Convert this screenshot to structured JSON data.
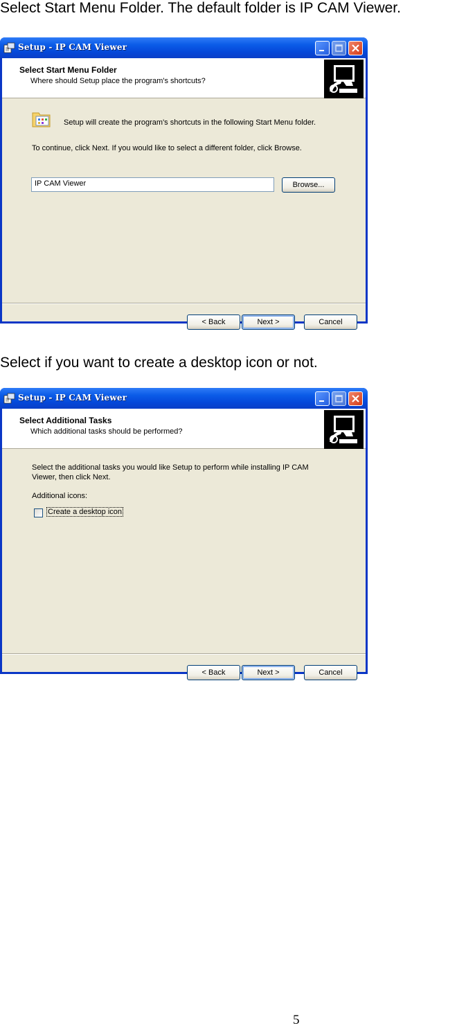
{
  "caption1": "Select Start Menu Folder. The default folder is IP CAM Viewer.",
  "caption2": "Select if you want to create a desktop icon or not.",
  "page_number": "5",
  "window1": {
    "title": "Setup - IP CAM Viewer",
    "header_title": "Select Start Menu Folder",
    "header_subtitle": "Where should Setup place the program's shortcuts?",
    "info_text": "Setup will create the program's shortcuts in the following Start Menu folder.",
    "instruction": "To continue, click Next. If you would like to select a different folder, click Browse.",
    "folder_value": "IP CAM Viewer",
    "browse_label": "Browse...",
    "back_label": "< Back",
    "next_label": "Next >",
    "cancel_label": "Cancel"
  },
  "window2": {
    "title": "Setup - IP CAM Viewer",
    "header_title": "Select Additional Tasks",
    "header_subtitle": "Which additional tasks should be performed?",
    "instruction": "Select the additional tasks you would like Setup to perform while installing IP CAM Viewer, then click Next.",
    "group_label": "Additional icons:",
    "checkbox_label": "Create a desktop icon",
    "checkbox_checked": false,
    "back_label": "< Back",
    "next_label": "Next >",
    "cancel_label": "Cancel"
  },
  "colors": {
    "titlebar": "#0b5ce8",
    "dialog_bg": "#ece9d8",
    "close_button": "#d33a16"
  },
  "icons": [
    "setup-app-icon",
    "minimize-icon",
    "maximize-icon",
    "close-icon",
    "computer-install-icon",
    "start-menu-folder-icon"
  ]
}
